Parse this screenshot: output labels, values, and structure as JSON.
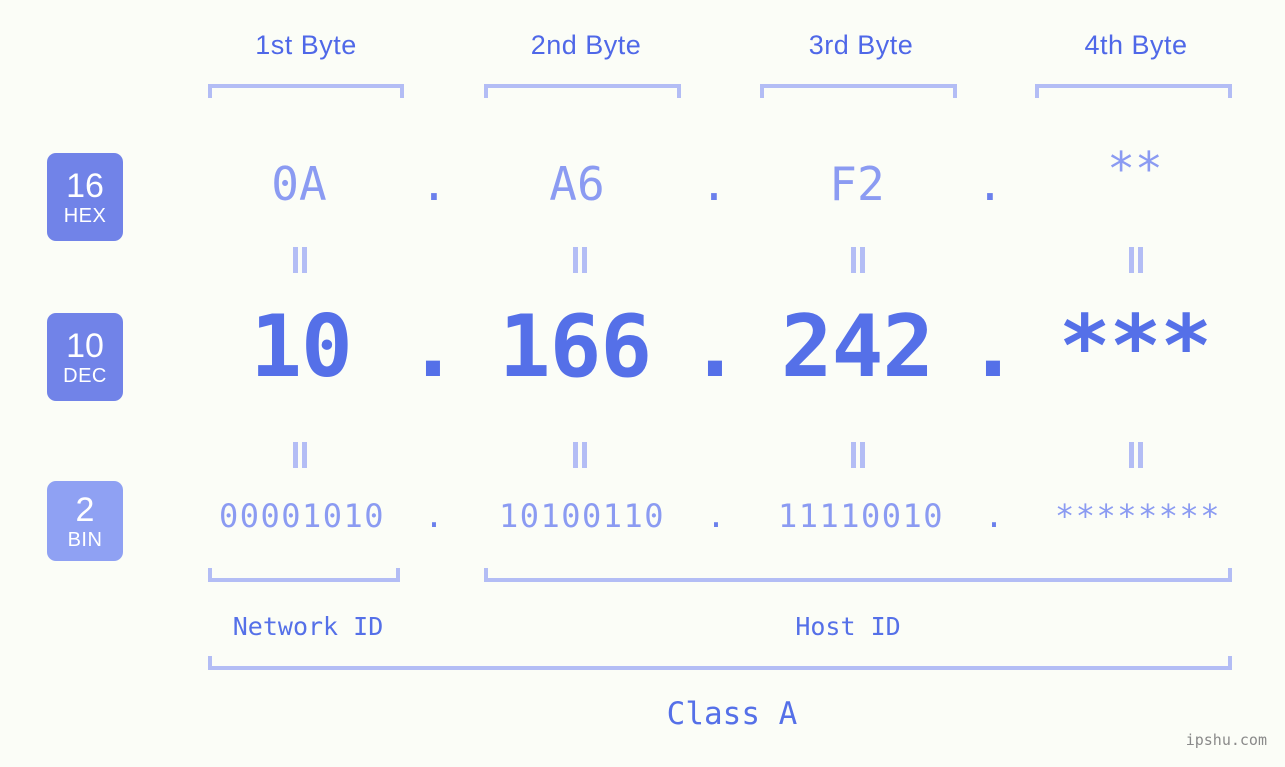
{
  "meta": {
    "background": "#fbfdf7",
    "accent_blue": "#5570e8",
    "light_blue": "#8b9bf2",
    "bracket_blue": "#b3bdf5",
    "badge_blue": "#7183e8",
    "badge_blue_light": "#8fa1f3",
    "watermark": "ipshu.com"
  },
  "headers": [
    {
      "label": "1st Byte"
    },
    {
      "label": "2nd Byte"
    },
    {
      "label": "3rd Byte"
    },
    {
      "label": "4th Byte"
    }
  ],
  "bases": [
    {
      "number": "16",
      "name": "HEX"
    },
    {
      "number": "10",
      "name": "DEC"
    },
    {
      "number": "2",
      "name": "BIN"
    }
  ],
  "rows": {
    "hex": {
      "base_number": "16",
      "base_name": "HEX",
      "values": [
        "0A",
        "A6",
        "F2",
        "**"
      ],
      "separators": [
        ".",
        ".",
        "."
      ]
    },
    "dec": {
      "base_number": "10",
      "base_name": "DEC",
      "values": [
        "10",
        "166",
        "242",
        "***"
      ],
      "separators": [
        ".",
        ".",
        "."
      ]
    },
    "bin": {
      "base_number": "2",
      "base_name": "BIN",
      "values": [
        "00001010",
        "10100110",
        "11110010",
        "********"
      ],
      "separators": [
        ".",
        ".",
        "."
      ]
    }
  },
  "equals_connectors": {
    "symbol": "=",
    "count_per_row": 4
  },
  "sections": [
    {
      "label": "Network ID"
    },
    {
      "label": "Host ID"
    }
  ],
  "class": {
    "label": "Class A"
  }
}
